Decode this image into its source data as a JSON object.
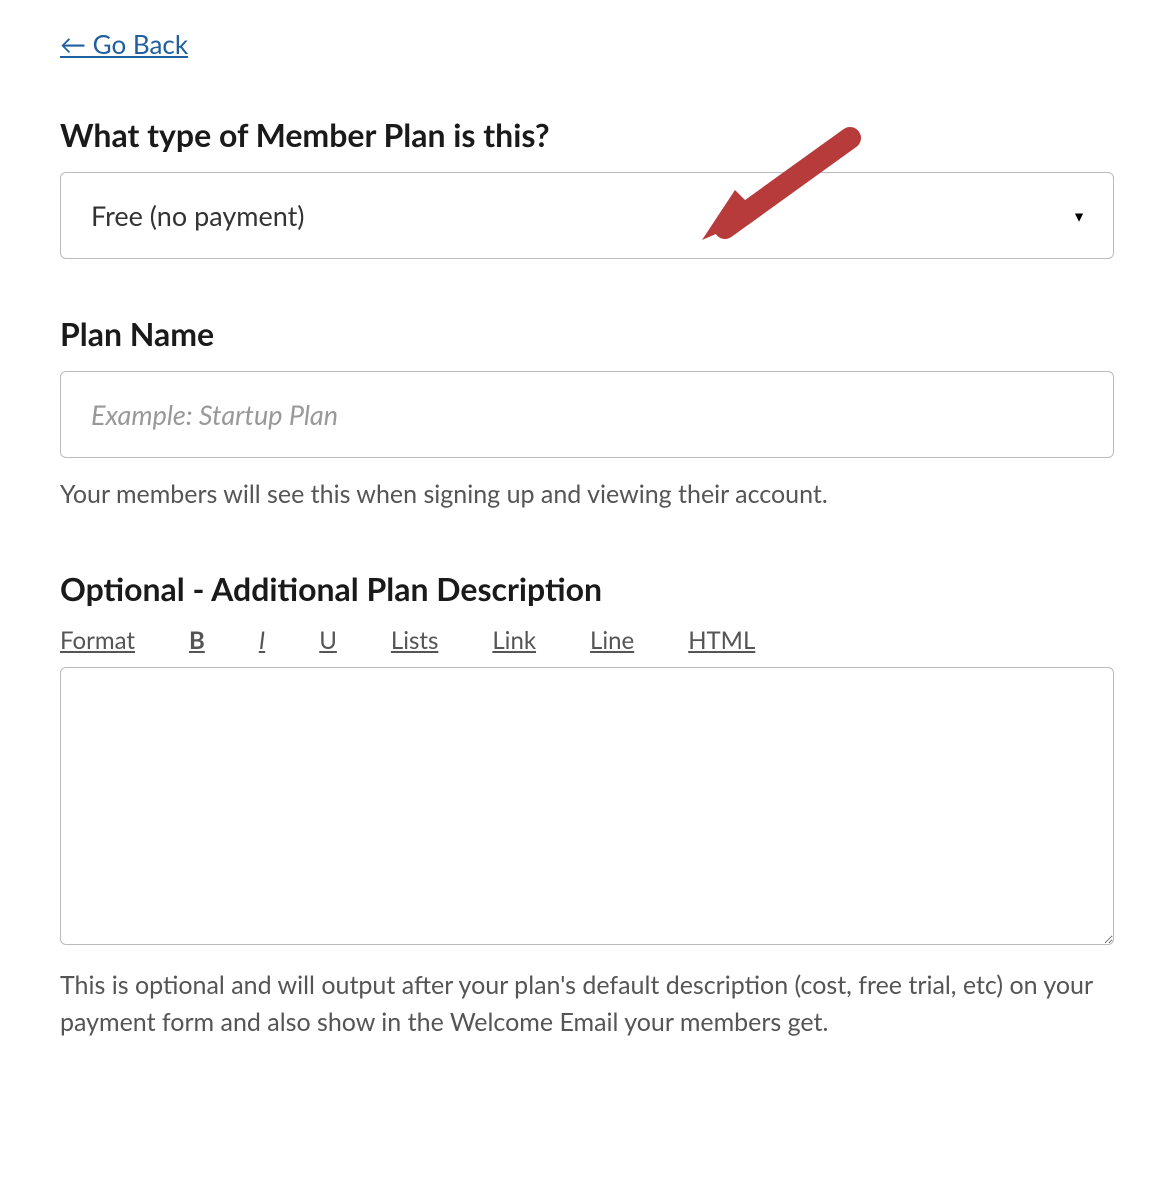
{
  "nav": {
    "go_back": "← Go Back"
  },
  "plan_type": {
    "heading": "What type of Member Plan is this?",
    "selected": "Free (no payment)"
  },
  "plan_name": {
    "heading": "Plan Name",
    "placeholder": "Example: Startup Plan",
    "help": "Your members will see this when signing up and viewing their account."
  },
  "description": {
    "heading": "Optional - Additional Plan Description",
    "toolbar": {
      "format": "Format",
      "bold": "B",
      "italic": "I",
      "underline": "U",
      "lists": "Lists",
      "link": "Link",
      "line": "Line",
      "html": "HTML"
    },
    "help": "This is optional and will output after your plan's default description (cost, free trial, etc) on your payment form and also show in the Welcome Email your members get."
  }
}
